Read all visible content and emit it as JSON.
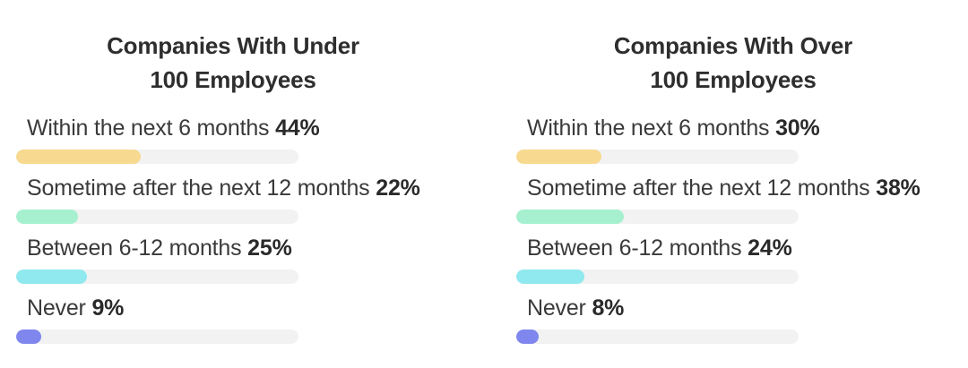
{
  "chart_data": [
    {
      "type": "bar",
      "title_lines": [
        "Companies With Under",
        "100 Employees"
      ],
      "categories": [
        "Within the next 6 months",
        "Sometime after the next 12 months",
        "Between 6-12 months",
        "Never"
      ],
      "values": [
        44,
        22,
        25,
        9
      ],
      "value_labels": [
        "44%",
        "22%",
        "25%",
        "9%"
      ],
      "colors": [
        "#f7d98f",
        "#a6f0cf",
        "#8fe9ee",
        "#7f86ee"
      ],
      "track_color": "#f2f2f3"
    },
    {
      "type": "bar",
      "title_lines": [
        "Companies With Over",
        "100 Employees"
      ],
      "categories": [
        "Within the next 6 months",
        "Sometime after the next 12 months",
        "Between 6-12 months",
        "Never"
      ],
      "values": [
        30,
        38,
        24,
        8
      ],
      "value_labels": [
        "30%",
        "38%",
        "24%",
        "8%"
      ],
      "colors": [
        "#f7d98f",
        "#a6f0cf",
        "#8fe9ee",
        "#7f86ee"
      ],
      "track_color": "#f2f2f3"
    }
  ]
}
